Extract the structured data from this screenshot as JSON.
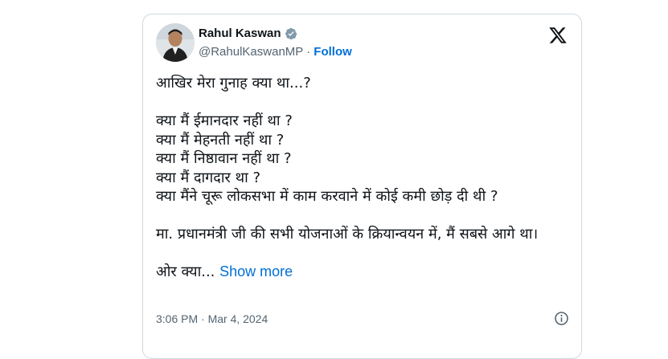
{
  "author": {
    "name": "Rahul Kaswan",
    "handle": "@RahulKaswanMP",
    "separator": "·",
    "follow_label": "Follow"
  },
  "tweet": {
    "line1": "आखिर मेरा गुनाह क्या था...?",
    "q1": "क्या मैं ईमानदार नहीं था ?",
    "q2": "क्या मैं मेहनती नहीं था ?",
    "q3": "क्या मैं निष्ठावान नहीं था ?",
    "q4": "क्या मैं दागदार था ?",
    "q5": "क्या मैंने चूरू लोकसभा में काम करवाने में कोई कमी छोड़ दी थी ?",
    "para2": "मा. प्रधानमंत्री जी की सभी योजनाओं के क्रियान्वयन में, मैं सबसे आगे था।",
    "last_line": "ओर क्या...",
    "show_more": "Show more"
  },
  "meta": {
    "timestamp": "3:06 PM · Mar 4, 2024"
  },
  "icons": {
    "verified": "verified-badge-icon",
    "brand": "x-logo-icon",
    "info": "info-icon"
  },
  "colors": {
    "link": "#006fd6",
    "verified_badge": "#829aab",
    "text": "#0f1419",
    "secondary": "#536471",
    "border": "#cfd9de"
  }
}
